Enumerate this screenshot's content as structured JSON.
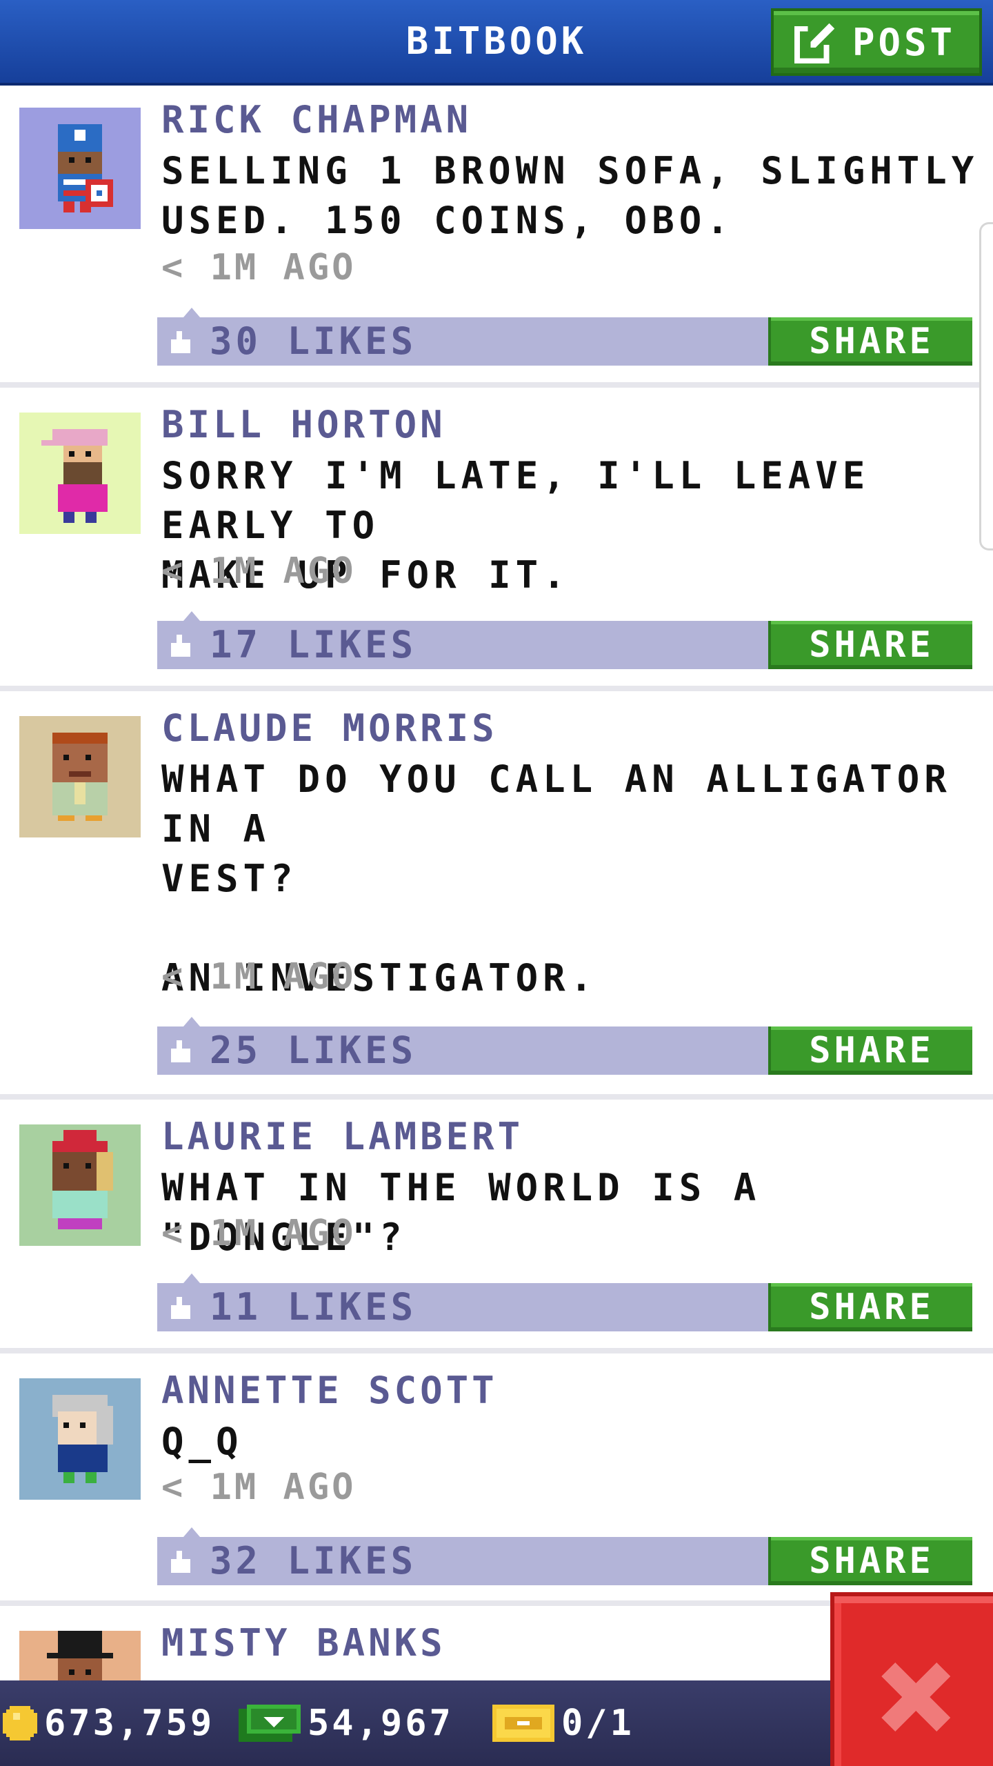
{
  "header": {
    "title": "BITBOOK",
    "post_label": "POST"
  },
  "posts": [
    {
      "author": "RICK CHAPMAN",
      "text": "SELLING 1 BROWN SOFA, SLIGHTLY\nUSED. 150 COINS, OBO.",
      "time": "< 1M AGO",
      "likes": "30 LIKES",
      "share": "SHARE"
    },
    {
      "author": "BILL HORTON",
      "text": "SORRY I'M LATE, I'LL LEAVE EARLY TO\nMAKE UP FOR IT.",
      "time": "< 1M AGO",
      "likes": "17 LIKES",
      "share": "SHARE"
    },
    {
      "author": "CLAUDE MORRIS",
      "text": "WHAT DO YOU CALL AN ALLIGATOR IN A\nVEST?\n\nAN INVESTIGATOR.",
      "time": "< 1M AGO",
      "likes": "25 LIKES",
      "share": "SHARE"
    },
    {
      "author": "LAURIE LAMBERT",
      "text": "WHAT IN THE WORLD IS A \"DONGLE\"?",
      "time": "< 1M AGO",
      "likes": "11 LIKES",
      "share": "SHARE"
    },
    {
      "author": "ANNETTE SCOTT",
      "text": "Q_Q",
      "time": "< 1M AGO",
      "likes": "32 LIKES",
      "share": "SHARE"
    },
    {
      "author": "MISTY BANKS"
    }
  ],
  "status": {
    "coins": "673,759",
    "bux": "54,967",
    "tickets": "0/1"
  },
  "colors": {
    "header_blue": "#1f4fae",
    "button_green": "#3a9a2a",
    "likes_bar": "#b3b4d8",
    "author_purple": "#5a5a92",
    "close_red": "#e02a2a"
  },
  "icons": [
    "edit-icon",
    "thumbs-up-icon",
    "coin-icon",
    "bux-icon",
    "ticket-icon",
    "close-icon"
  ]
}
